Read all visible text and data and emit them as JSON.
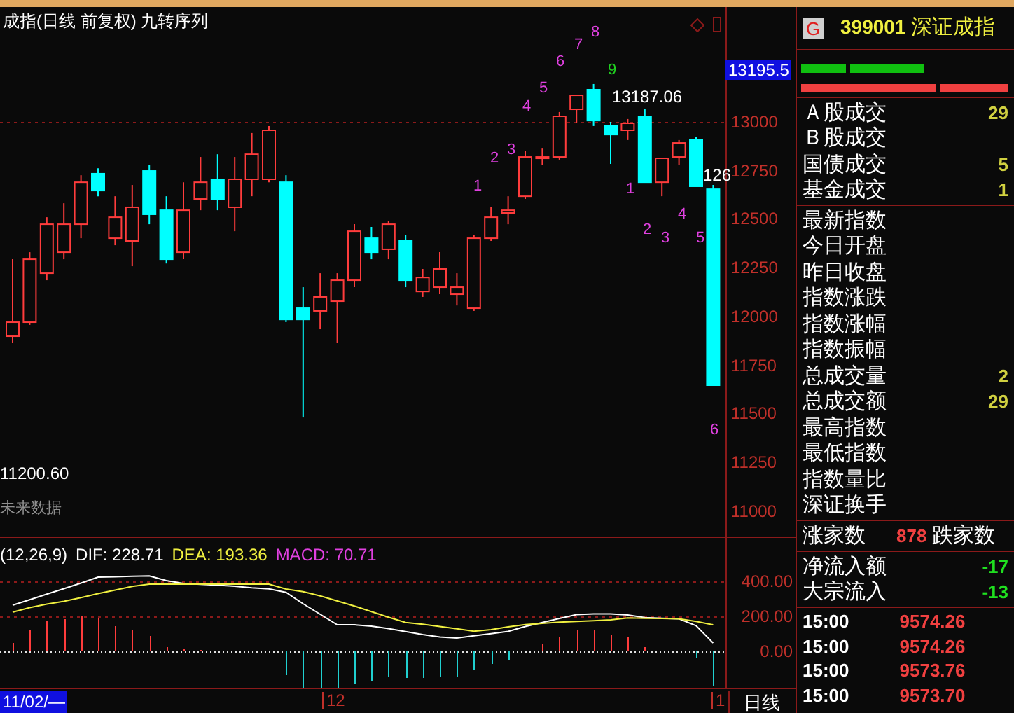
{
  "chart": {
    "title": "成指(日线 前复权) 九转序列",
    "chart_data": {
      "type": "candlestick",
      "ylim": [
        10868,
        13591
      ],
      "yticks": [
        13000,
        12750,
        12500,
        12250,
        12000,
        11750,
        11500,
        11250,
        11000
      ],
      "ohlc": [
        [
          11898,
          12294,
          11862,
          11970
        ],
        [
          11970,
          12330,
          11956,
          12294
        ],
        [
          12222,
          12510,
          12186,
          12474
        ],
        [
          12330,
          12582,
          12294,
          12474
        ],
        [
          12474,
          12726,
          12402,
          12690
        ],
        [
          12734,
          12762,
          12618,
          12647
        ],
        [
          12402,
          12618,
          12366,
          12510
        ],
        [
          12388,
          12676,
          12258,
          12561
        ],
        [
          12748,
          12777,
          12474,
          12525
        ],
        [
          12546,
          12618,
          12272,
          12294
        ],
        [
          12330,
          12690,
          12294,
          12546
        ],
        [
          12604,
          12820,
          12546,
          12690
        ],
        [
          12705,
          12834,
          12546,
          12604
        ],
        [
          12561,
          12820,
          12438,
          12705
        ],
        [
          12705,
          12943,
          12618,
          12834
        ],
        [
          12705,
          12979,
          12690,
          12957
        ],
        [
          12690,
          12726,
          11970,
          11984
        ],
        [
          12042,
          12150,
          11480,
          11984
        ],
        [
          12028,
          12222,
          11934,
          12100
        ],
        [
          12078,
          12222,
          11862,
          12186
        ],
        [
          12186,
          12474,
          12150,
          12438
        ],
        [
          12402,
          12460,
          12294,
          12330
        ],
        [
          12345,
          12489,
          12294,
          12474
        ],
        [
          12388,
          12417,
          12150,
          12186
        ],
        [
          12128,
          12244,
          12100,
          12200
        ],
        [
          12150,
          12330,
          12114,
          12244
        ],
        [
          12114,
          12222,
          12056,
          12150
        ],
        [
          12042,
          12417,
          12028,
          12402
        ],
        [
          12402,
          12561,
          12388,
          12510
        ],
        [
          12532,
          12618,
          12474,
          12546
        ],
        [
          12618,
          12849,
          12604,
          12820
        ],
        [
          12820,
          12863,
          12777,
          12820
        ],
        [
          12820,
          13051,
          12806,
          13029
        ],
        [
          13065,
          13137,
          12993,
          13137
        ],
        [
          13166,
          13195,
          12979,
          13007
        ],
        [
          12979,
          13000,
          12784,
          12935
        ],
        [
          12957,
          13015,
          12907,
          12993
        ],
        [
          13029,
          13065,
          12690,
          12690
        ],
        [
          12690,
          12813,
          12618,
          12813
        ],
        [
          12820,
          12907,
          12777,
          12892
        ],
        [
          12907,
          12921,
          12669,
          12669
        ],
        [
          12654,
          12676,
          11646,
          11646
        ]
      ]
    },
    "current_price": "13195.5",
    "annotations": [
      {
        "text": "1",
        "color": "#e040e0"
      },
      {
        "text": "2",
        "color": "#e040e0"
      },
      {
        "text": "3",
        "color": "#e040e0"
      },
      {
        "text": "4",
        "color": "#e040e0"
      },
      {
        "text": "5",
        "color": "#e040e0"
      },
      {
        "text": "6",
        "color": "#e040e0"
      },
      {
        "text": "7",
        "color": "#e040e0"
      },
      {
        "text": "8",
        "color": "#e040e0"
      },
      {
        "text": "9",
        "color": "#20d020"
      },
      {
        "text": "13187.06",
        "color": "#ffffff"
      },
      {
        "text": "1",
        "color": "#e040e0"
      },
      {
        "text": "2",
        "color": "#e040e0"
      },
      {
        "text": "3",
        "color": "#e040e0"
      },
      {
        "text": "4",
        "color": "#e040e0"
      },
      {
        "text": "5",
        "color": "#e040e0"
      },
      {
        "text": "126",
        "color": "#ffffff"
      },
      {
        "text": "6",
        "color": "#e040e0"
      },
      {
        "text": "11200.60",
        "color": "#ffffff"
      },
      {
        "text": "未来数据",
        "color": "#909090"
      }
    ]
  },
  "macd": {
    "params": "(12,26,9)",
    "dif": ": 228.71",
    "dea": ": 193.36",
    "value": "MACD: 70.71",
    "chart_data": {
      "type": "line",
      "ylim": [
        -216,
        648
      ],
      "yticks": [
        {
          "value": 400,
          "label": "400.00"
        },
        {
          "value": 200,
          "label": "200.00"
        },
        {
          "value": 0,
          "label": "0.00"
        }
      ],
      "series": [
        {
          "name": "DIF",
          "color": "#ffffff",
          "values": [
            264,
            295,
            327,
            358,
            390,
            424,
            426,
            429,
            431,
            404,
            388,
            383,
            378,
            372,
            363,
            357,
            337,
            272,
            212,
            152,
            152,
            144,
            130,
            113,
            96,
            82,
            76,
            89,
            101,
            114,
            142,
            165,
            188,
            210,
            214,
            214,
            208,
            193,
            189,
            186,
            147,
            48
          ]
        },
        {
          "name": "DEA",
          "color": "#f0f040",
          "values": [
            224,
            250,
            270,
            286,
            307,
            330,
            350,
            371,
            384,
            384,
            384,
            384,
            384,
            384,
            384,
            384,
            356,
            341,
            317,
            288,
            259,
            227,
            195,
            165,
            155,
            142,
            129,
            115,
            124,
            140,
            153,
            160,
            167,
            171,
            175,
            180,
            191,
            189,
            188,
            186,
            171,
            152
          ]
        }
      ]
    }
  },
  "timeline": {
    "start": "11/02/—",
    "marks": [
      "12",
      "1"
    ],
    "period": "日线"
  },
  "quote": {
    "logo": "G",
    "code": "399001",
    "name": "深证成指",
    "turnover": [
      {
        "label": "Ａ股成交",
        "value": "29"
      },
      {
        "label": "Ｂ股成交"
      },
      {
        "label": "国债成交",
        "value": "5"
      },
      {
        "label": "基金成交",
        "value": "1"
      }
    ],
    "fields": [
      {
        "label": "最新指数"
      },
      {
        "label": "今日开盘"
      },
      {
        "label": "昨日收盘"
      },
      {
        "label": "指数涨跌"
      },
      {
        "label": "指数涨幅"
      },
      {
        "label": "指数振幅"
      },
      {
        "label": "总成交量",
        "value": "2"
      },
      {
        "label": "总成交额",
        "value": "29"
      },
      {
        "label": "最高指数"
      },
      {
        "label": "最低指数"
      },
      {
        "label": "指数量比"
      },
      {
        "label": "深证换手"
      }
    ],
    "breadth": {
      "label": "涨家数",
      "value": "878",
      "label_2": "跌家数"
    },
    "flows": [
      {
        "label": "净流入额",
        "value": "-17"
      },
      {
        "label": "大宗流入",
        "value": "-13"
      }
    ],
    "ticks": [
      {
        "time": "15:00",
        "price": "9574.26"
      },
      {
        "time": "15:00",
        "price": "9574.26"
      },
      {
        "time": "15:00",
        "price": "9573.76"
      },
      {
        "time": "15:00",
        "price": "9573.70"
      }
    ]
  }
}
